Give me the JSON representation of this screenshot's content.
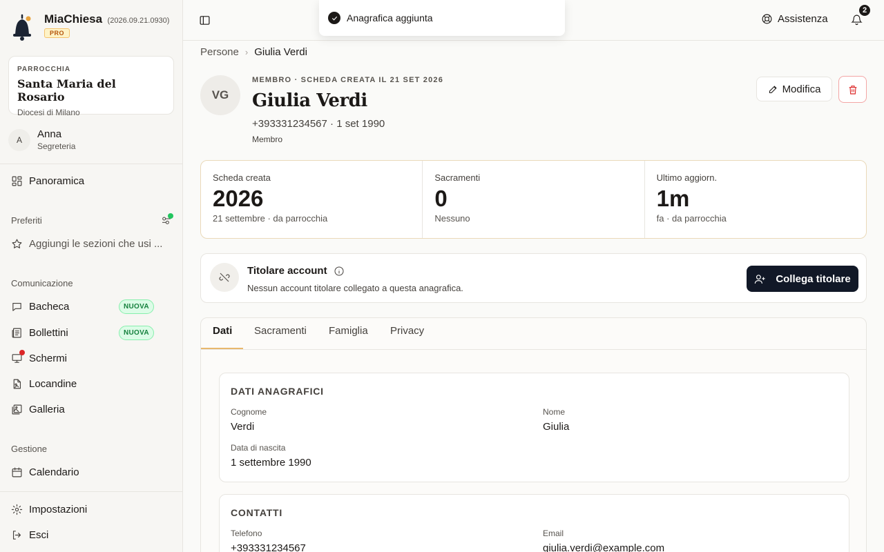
{
  "app": {
    "name": "MiaChiesa",
    "version": "(2026.09.21.0930)",
    "plan_badge": "PRO"
  },
  "parish": {
    "label": "PARROCCHIA",
    "name": "Santa Maria del Rosario",
    "diocese": "Diocesi di Milano"
  },
  "user": {
    "initial": "A",
    "name": "Anna",
    "role": "Segreteria"
  },
  "nav": {
    "overview": "Panoramica",
    "favorites_label": "Preferiti",
    "favorites_placeholder": "Aggiungi le sezioni che usi ...",
    "communication_label": "Comunicazione",
    "bacheca": "Bacheca",
    "bollettini": "Bollettini",
    "new_badge": "NUOVA",
    "schermi": "Schermi",
    "locandine": "Locandine",
    "galleria": "Galleria",
    "management_label": "Gestione",
    "calendario": "Calendario",
    "impostazioni": "Impostazioni",
    "esci": "Esci"
  },
  "topbar": {
    "assist_label": "Assistenza",
    "notification_count": "2"
  },
  "toast": {
    "message": "Anagrafica aggiunta"
  },
  "breadcrumb": {
    "parent": "Persone",
    "current": "Giulia Verdi"
  },
  "person": {
    "initials": "VG",
    "overline": "MEMBRO · SCHEDA CREATA IL 21 SET 2026",
    "name": "Giulia Verdi",
    "contact_line": "+393331234567 · 1 set 1990",
    "role": "Membro",
    "edit_label": "Modifica"
  },
  "stats": [
    {
      "label": "Scheda creata",
      "value": "2026",
      "sub": "21 settembre · da parrocchia"
    },
    {
      "label": "Sacramenti",
      "value": "0",
      "sub": "Nessuno"
    },
    {
      "label": "Ultimo aggiorn.",
      "value": "1m",
      "sub": "fa · da parrocchia"
    }
  ],
  "account": {
    "title": "Titolare account",
    "description": "Nessun account titolare collegato a questa anagrafica.",
    "link_button": "Collega titolare"
  },
  "tabs": [
    "Dati",
    "Sacramenti",
    "Famiglia",
    "Privacy"
  ],
  "dati_anagrafici": {
    "title": "DATI ANAGRAFICI",
    "cognome_label": "Cognome",
    "cognome": "Verdi",
    "nome_label": "Nome",
    "nome": "Giulia",
    "nascita_label": "Data di nascita",
    "nascita": "1 settembre 1990"
  },
  "contatti": {
    "title": "CONTATTI",
    "telefono_label": "Telefono",
    "telefono": "+393331234567",
    "email_label": "Email",
    "email": "giulia.verdi@example.com"
  }
}
